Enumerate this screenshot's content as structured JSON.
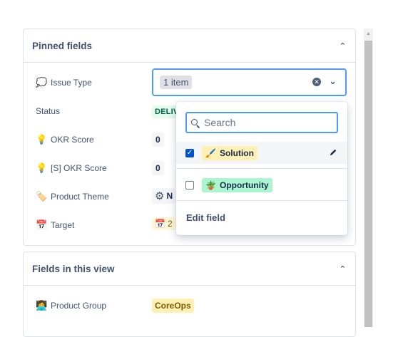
{
  "pinned": {
    "title": "Pinned fields",
    "fields": [
      {
        "label": "Issue Type",
        "icon": "speech-bubble-icon"
      },
      {
        "label": "Status",
        "value": "DELIV"
      },
      {
        "label": "OKR Score",
        "icon": "lightbulb-icon",
        "value": "0"
      },
      {
        "label": "[S] OKR Score",
        "icon": "lightbulb-icon",
        "value": "0"
      },
      {
        "label": "Product Theme",
        "icon": "label-tag-icon",
        "value": "N"
      },
      {
        "label": "Target",
        "icon": "calendar-icon",
        "value": "2"
      }
    ]
  },
  "select": {
    "value": "1 item"
  },
  "dropdown": {
    "search_placeholder": "Search",
    "options": [
      {
        "label": "Solution",
        "checked": true,
        "color": "#fff0b3",
        "icon": "paintbrush-icon"
      },
      {
        "label": "Opportunity",
        "checked": false,
        "color": "#abf5d1",
        "icon": "potted-plant-icon"
      }
    ],
    "edit_label": "Edit field"
  },
  "fields_view": {
    "title": "Fields in this view",
    "fields": [
      {
        "label": "Product Group",
        "icon": "technologist-icon",
        "value": "CoreOps"
      }
    ]
  }
}
